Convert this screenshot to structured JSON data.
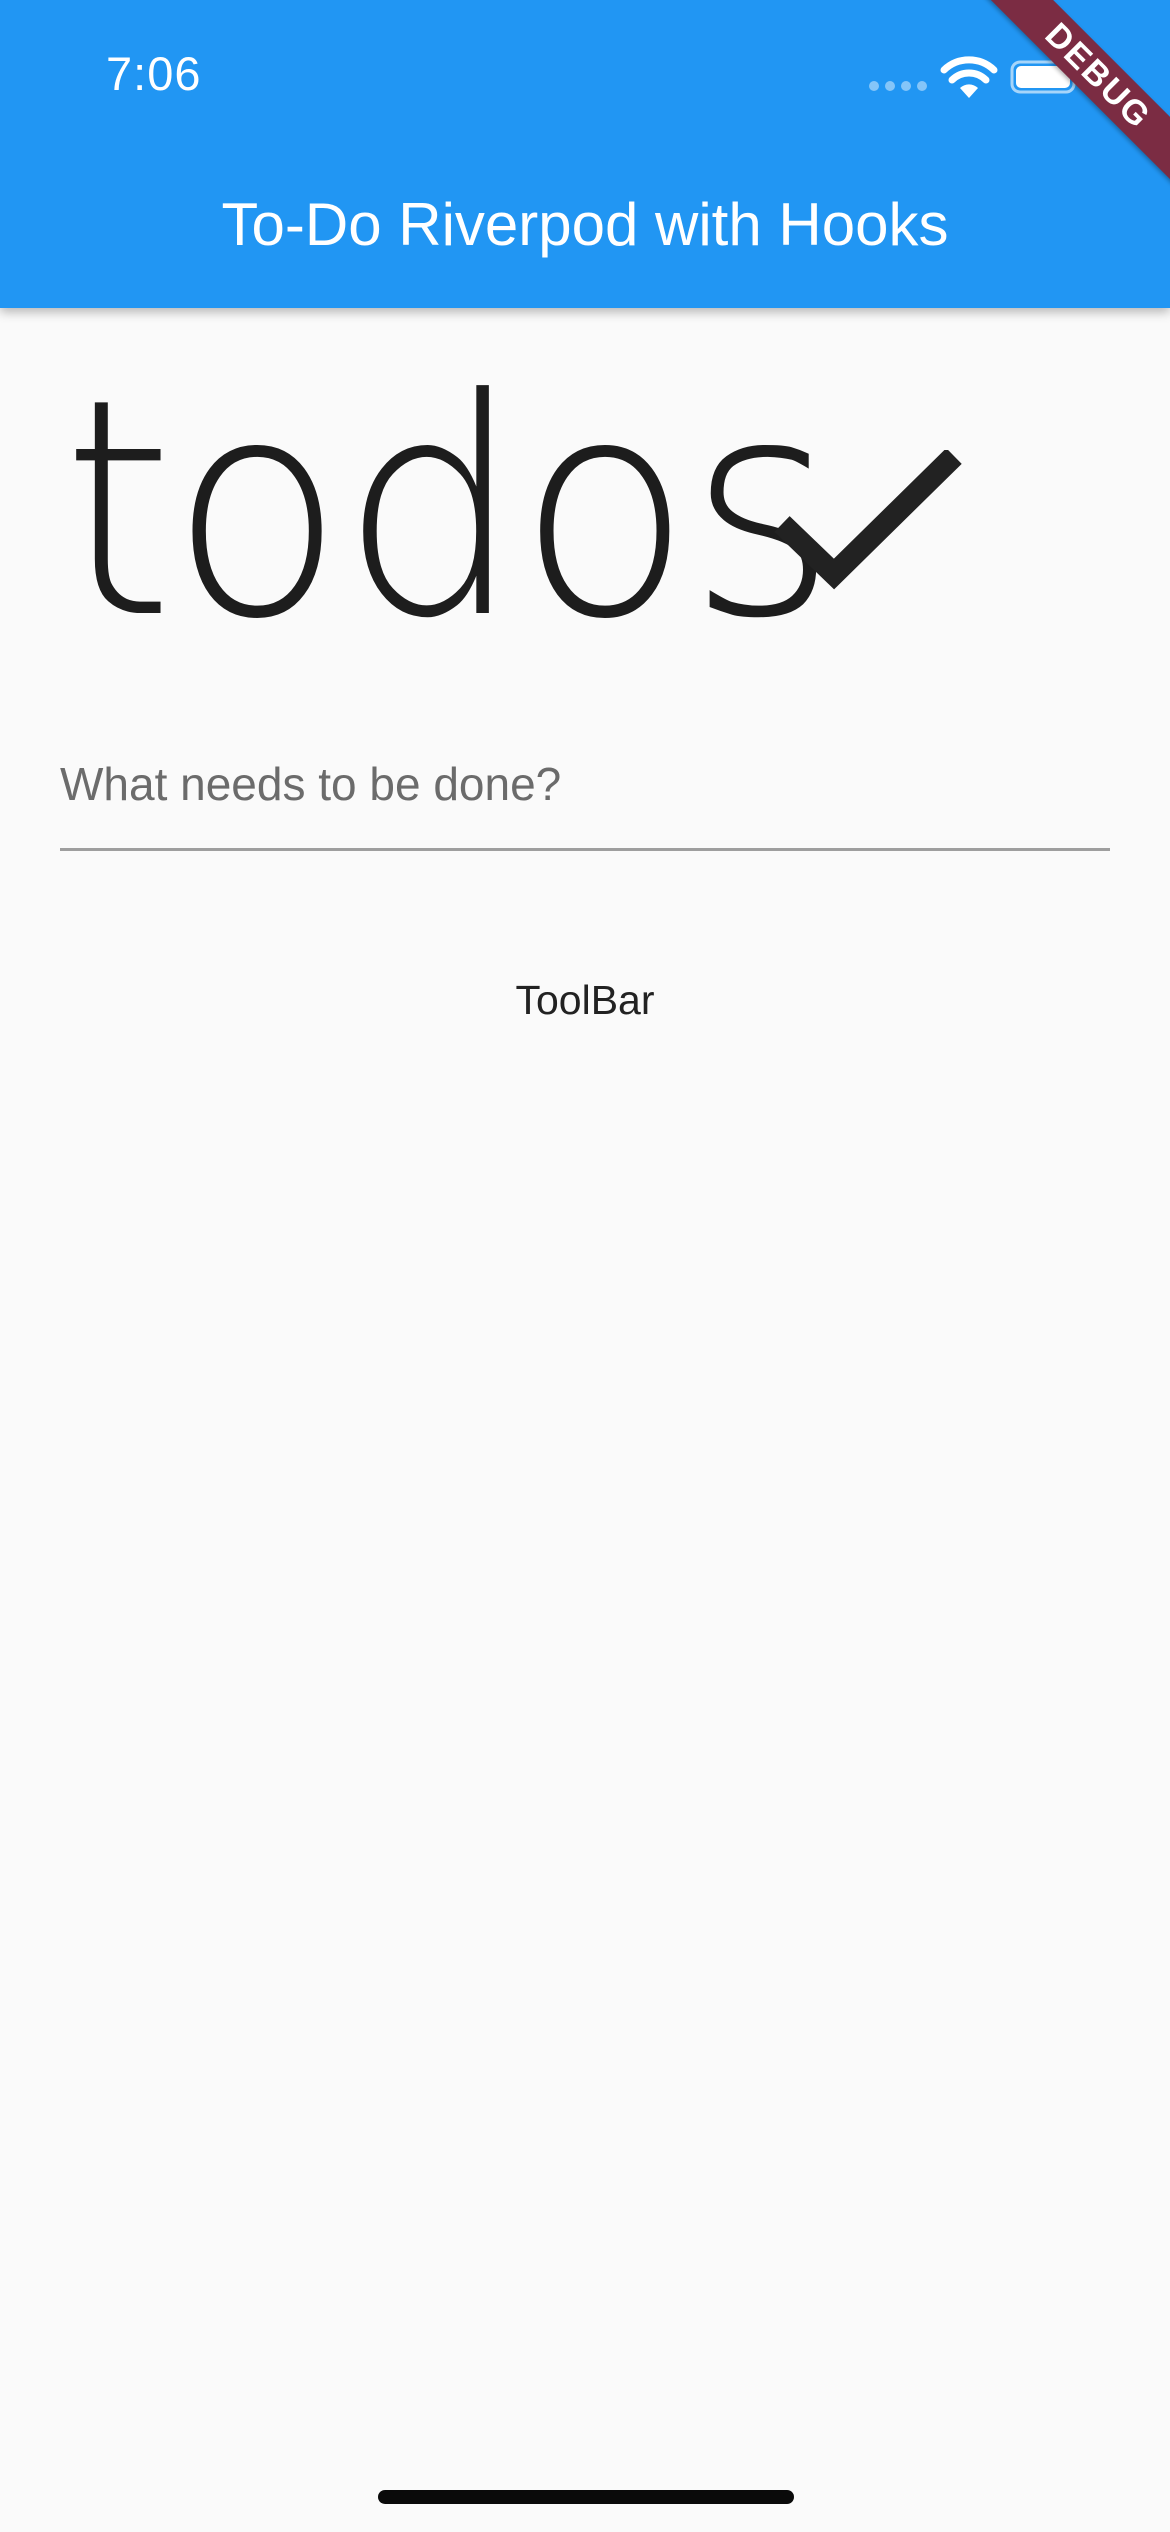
{
  "status_bar": {
    "time": "7:06",
    "icons": [
      "cellular-signal-icon",
      "wifi-icon",
      "battery-icon"
    ]
  },
  "app_bar": {
    "title": "To-Do Riverpod with Hooks",
    "color": "#2196f3"
  },
  "debug_banner": {
    "label": "DEBUG",
    "color": "#7b2c43"
  },
  "logo": {
    "text": "todos",
    "icon": "check-icon"
  },
  "new_todo": {
    "placeholder": "What needs to be done?",
    "value": ""
  },
  "toolbar": {
    "label": "ToolBar"
  }
}
